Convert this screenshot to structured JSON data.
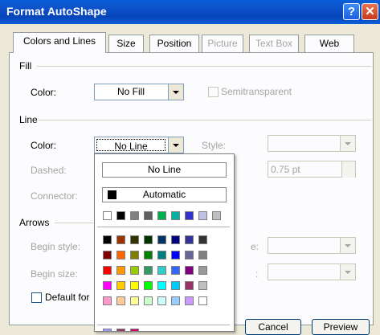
{
  "window": {
    "title": "Format AutoShape",
    "help_glyph": "?",
    "close_glyph": "✕"
  },
  "tabs": [
    {
      "label": "Colors and Lines",
      "selected": true
    },
    {
      "label": "Size"
    },
    {
      "label": "Position"
    },
    {
      "label": "Picture",
      "disabled": true
    },
    {
      "label": "Text Box",
      "disabled": true
    },
    {
      "label": "Web"
    }
  ],
  "fill": {
    "section": "Fill",
    "color_label": "Color:",
    "color_value": "No Fill",
    "semitransparent_label": "Semitransparent"
  },
  "line": {
    "section": "Line",
    "color_label": "Color:",
    "color_value": "No Line",
    "style_label": "Style:",
    "dashed_label": "Dashed:",
    "weight_value": "0.75 pt",
    "connector_label": "Connector:"
  },
  "arrows": {
    "section": "Arrows",
    "begin_style_label": "Begin style:",
    "begin_size_label": "Begin size:",
    "end_style_label_fragment": "e:",
    "end_size_label_fragment": ":"
  },
  "default_for_label": "Default for",
  "dropdown": {
    "no_line": "No Line",
    "automatic": "Automatic",
    "recent": [
      "#ffffff",
      "#000000",
      "#808080",
      "#606060",
      "#00b050",
      "#00b0a0",
      "#3333cc",
      "#c0c0e0",
      "#c0c0c0"
    ],
    "palette": [
      [
        "#000000",
        "#993300",
        "#333300",
        "#003300",
        "#003366",
        "#000080",
        "#333399",
        "#333333"
      ],
      [
        "#800000",
        "#ff6600",
        "#808000",
        "#008000",
        "#008080",
        "#0000ff",
        "#666699",
        "#808080"
      ],
      [
        "#ff0000",
        "#ff9900",
        "#99cc00",
        "#339966",
        "#33cccc",
        "#3366ff",
        "#800080",
        "#999999"
      ],
      [
        "#ff00ff",
        "#ffcc00",
        "#ffff00",
        "#00ff00",
        "#00ffff",
        "#00ccff",
        "#993366",
        "#c0c0c0"
      ],
      [
        "#ff99cc",
        "#ffcc99",
        "#ffff99",
        "#ccffcc",
        "#ccffff",
        "#99ccff",
        "#cc99ff",
        "#ffffff"
      ]
    ],
    "extra": [
      "#9999ff",
      "#993366",
      "#cc0066"
    ]
  },
  "buttons": {
    "cancel": "Cancel",
    "preview": "Preview"
  }
}
